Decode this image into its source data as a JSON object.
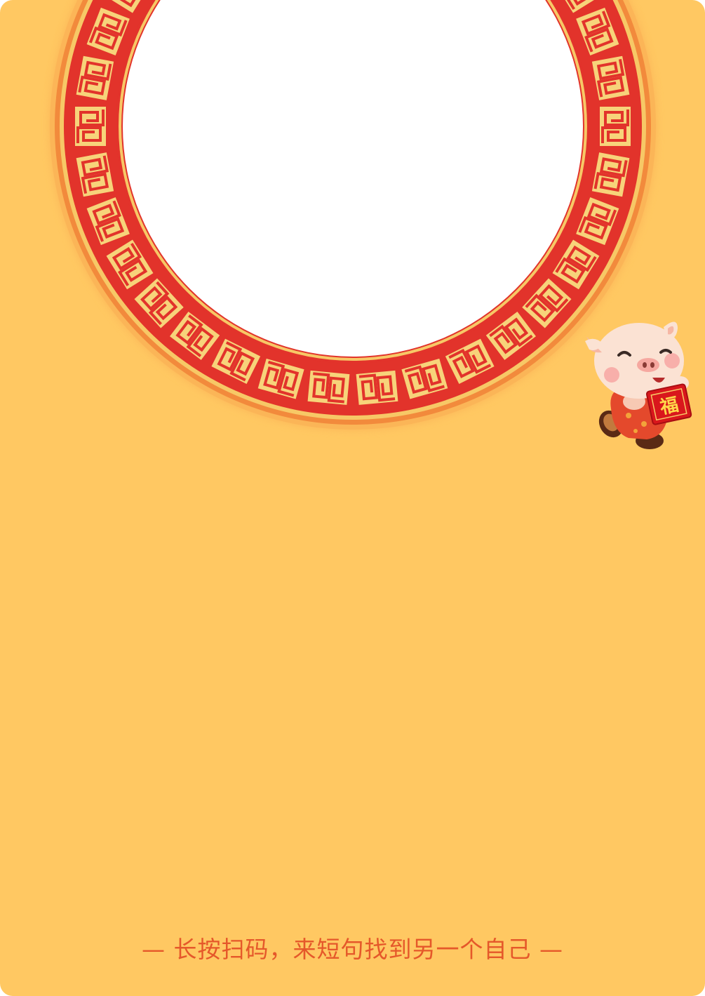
{
  "poster": {
    "background_color": "#ffc862",
    "photo_area_color": "#ffffff",
    "frame_colors": {
      "red": "#e2332b",
      "gold": "#f7d37a",
      "orange_edge": "#f59140"
    }
  },
  "mascot": {
    "icon": "pig-mascot-icon",
    "red_envelope_text": "福"
  },
  "footer": {
    "text": "— 长按扫码，来短句找到另一个自己 —"
  }
}
